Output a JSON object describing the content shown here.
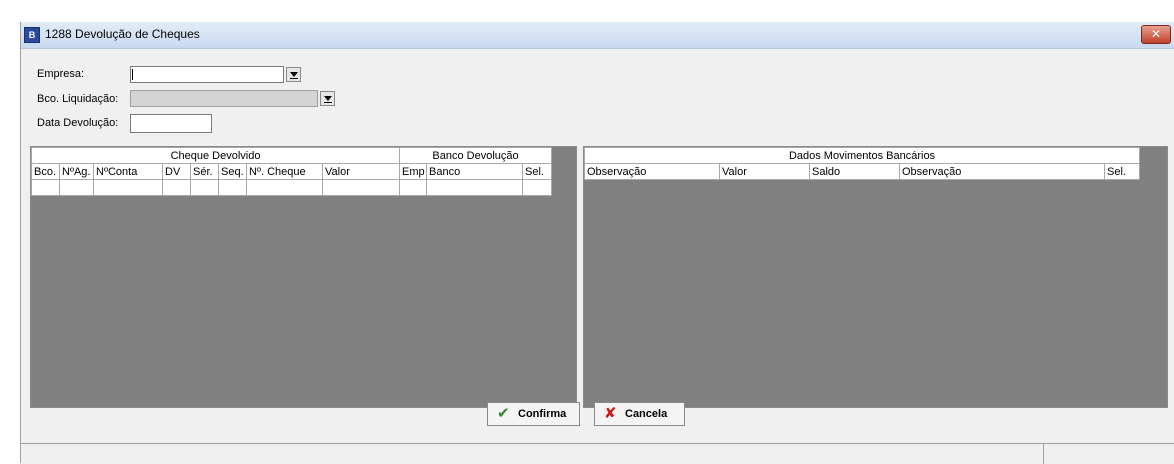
{
  "window": {
    "title": "1288 Devolução de Cheques",
    "icon": "app-icon",
    "icon_text": "B"
  },
  "form": {
    "empresa_label": "Empresa:",
    "empresa_value": "",
    "bco_liquidacao_label": "Bco. Liquidação:",
    "bco_liquidacao_value": "",
    "data_devolucao_label": "Data Devolução:",
    "data_devolucao_value": ""
  },
  "left_grid": {
    "group1": "Cheque Devolvido",
    "group2": "Banco Devolução",
    "columns": [
      "Bco.",
      "NºAg.",
      "NºConta",
      "DV",
      "Sér.",
      "Seq.",
      "Nº. Cheque",
      "Valor",
      "Emp",
      "Banco",
      "Sel."
    ]
  },
  "right_grid": {
    "group": "Dados Movimentos Bancários",
    "columns": [
      "Observação",
      "Valor",
      "Saldo",
      "Observação",
      "Sel."
    ]
  },
  "buttons": {
    "confirma": "Confirma",
    "cancela": "Cancela"
  },
  "colors": {
    "grid_background": "#808080",
    "confirm_icon": "#2e8b2e",
    "cancel_icon": "#cc1a1a"
  }
}
